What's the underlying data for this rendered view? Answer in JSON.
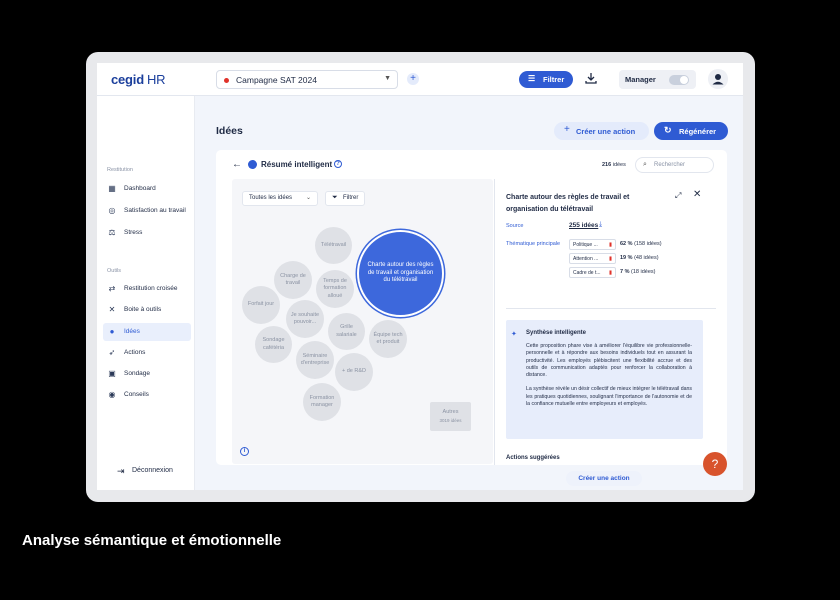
{
  "header": {
    "logo_brand": "cegid",
    "logo_product": "HR",
    "campaign": "Campagne SAT 2024",
    "filter_label": "Filtrer",
    "manager_label": "Manager"
  },
  "sidebar": {
    "section_restitution": "Restitution",
    "section_tools": "Outils",
    "items_restitution": [
      {
        "label": "Dashboard",
        "icon": "grid-icon"
      },
      {
        "label": "Satisfaction au travail",
        "icon": "award-icon"
      },
      {
        "label": "Stress",
        "icon": "balance-icon"
      }
    ],
    "items_tools": [
      {
        "label": "Restitution croisée",
        "icon": "arrows-icon"
      },
      {
        "label": "Boite à outils",
        "icon": "tools-icon"
      },
      {
        "label": "Idées",
        "icon": "bulb-icon",
        "active": true
      },
      {
        "label": "Actions",
        "icon": "rocket-icon"
      },
      {
        "label": "Sondage",
        "icon": "poll-icon"
      },
      {
        "label": "Conseils",
        "icon": "target-icon"
      }
    ],
    "logout_label": "Déconnexion"
  },
  "main": {
    "title": "Idées",
    "create_action_label": "Créer une action",
    "regenerate_label": "Régénérer"
  },
  "card": {
    "title": "Résumé intelligent",
    "count_value": "216",
    "count_unit": "idées",
    "search_placeholder": "Rechercher",
    "select_label": "Toutes les idées",
    "filter_label": "Filtrer",
    "bubbles": [
      "Télétravail",
      "Charge de travail",
      "Temps de formation alloué",
      "Forfait jour",
      "Je souhaite pouvoir...",
      "Grille salariale",
      "Sondage cafétéria",
      "Équipe tech et produit",
      "Séminaire d'entreprise",
      "+ de R&D",
      "Formation manager",
      "Charte autour des règles de travail et organisation du télétravail"
    ],
    "other_label": "Autres",
    "other_count": "3019 idées"
  },
  "panel": {
    "title": "Charte autour des règles de travail et organisation du télétravail",
    "source_label": "Source",
    "source_value": "255 idées",
    "theme_label": "Thématique principale",
    "themes": [
      {
        "tag": "Politique ...",
        "percent": "62 %",
        "count": "(158 idées)"
      },
      {
        "tag": "Attention ...",
        "percent": "19 %",
        "count": "(48 idées)"
      },
      {
        "tag": "Cadre de t...",
        "percent": "7 %",
        "count": "(18 idées)"
      }
    ],
    "synthesis_title": "Synthèse intelligente",
    "synthesis_p1": "Cette proposition phare vise à améliorer l'équilibre vie professionnelle-personnelle et à répondre aux besoins individuels tout en assurant la productivité.",
    "synthesis_p2": "Les employés plébiscitent une flexibilité accrue et des outils de communication adaptés pour renforcer la collaboration à distance.",
    "synthesis_p3": "La synthèse révèle un désir collectif de mieux intégrer le télétravail dans les pratiques quotidiennes, soulignant l'importance de l'autonomie et de la confiance mutuelle entre employeurs et employés.",
    "suggested_label": "Actions suggérées",
    "create_action_label": "Créer une action"
  },
  "caption": "Analyse sémantique et émotionnelle",
  "colors": {
    "accent": "#2f5bd3",
    "bubble_active": "#3d68dc",
    "bubble": "#dfe1e6",
    "help": "#d8532c"
  }
}
